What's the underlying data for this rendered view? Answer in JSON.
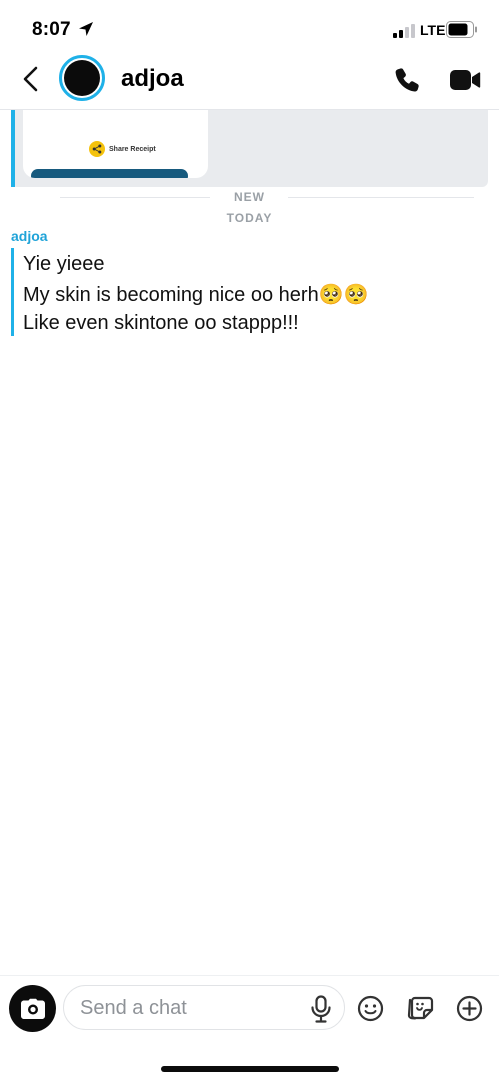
{
  "status_bar": {
    "time": "8:07",
    "network": "LTE",
    "icons": [
      "location-arrow-icon",
      "signal-icon",
      "battery-icon"
    ]
  },
  "header": {
    "contact_name": "adjoa",
    "icons": [
      "chevron-left-icon",
      "phone-icon",
      "video-camera-icon"
    ]
  },
  "previous_attachment": {
    "share_label": "Share Receipt",
    "icon": "share-icon"
  },
  "dividers": {
    "new_label": "NEW",
    "today_label": "TODAY"
  },
  "conversation": {
    "sender": "adjoa",
    "messages": [
      {
        "text": "Yie yieee"
      },
      {
        "text": "My skin is becoming nice oo herh🥺🥺"
      },
      {
        "text": "Like even skintone oo stappp!!!"
      }
    ]
  },
  "composer": {
    "placeholder": "Send a chat",
    "icons": [
      "camera-icon",
      "microphone-icon",
      "smiley-icon",
      "sticker-icon",
      "plus-icon"
    ]
  },
  "colors": {
    "accent": "#1fb1e8",
    "sender_name": "#1fa3d8",
    "divider_text": "#9aa0a6",
    "attachment_background": "#e9ebee",
    "receipt_footer": "#175a7e",
    "share_icon": "#f4c20d"
  }
}
